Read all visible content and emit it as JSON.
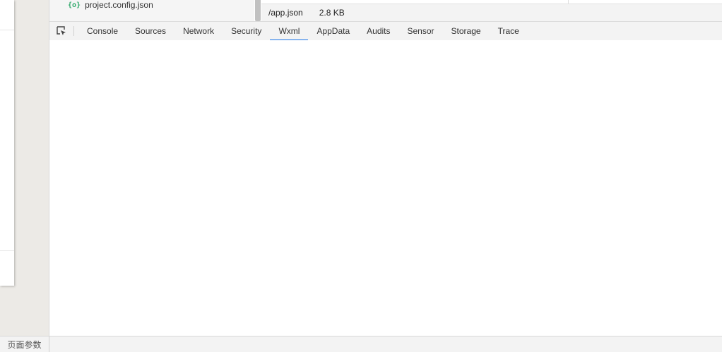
{
  "file_tree": {
    "item": {
      "icon": "{o}",
      "name": "project.config.json"
    }
  },
  "file_info": {
    "path": "/app.json",
    "size": "2.8 KB"
  },
  "devtools": {
    "tabs": [
      {
        "label": "Console"
      },
      {
        "label": "Sources"
      },
      {
        "label": "Network"
      },
      {
        "label": "Security"
      },
      {
        "label": "Wxml"
      },
      {
        "label": "AppData"
      },
      {
        "label": "Audits"
      },
      {
        "label": "Sensor"
      },
      {
        "label": "Storage"
      },
      {
        "label": "Trace"
      }
    ],
    "active_tab": "Wxml",
    "accent_color": "#1a73e8"
  },
  "status_bar": {
    "page_params": "页面参数"
  }
}
